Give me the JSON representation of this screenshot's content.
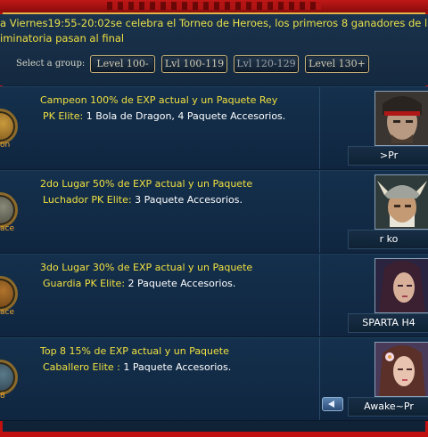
{
  "announcement": {
    "line1": "a Viernes19:55-20:02se celebra el Torneo de Heroes, los primeros 8 ganadores de la",
    "line2": "iminatoria pasan al final"
  },
  "group_select": {
    "label": "Select a group:",
    "buttons": [
      "Level 100-",
      "Lvl 100-119",
      "Lvl 120-129",
      "Level 130+"
    ]
  },
  "rows": [
    {
      "medal_text": "on",
      "title": "Campeon  100% de EXP actual y un Paquete Rey",
      "reward_class": "PK Elite:",
      "reward_text": " 1 Bola de Dragon, 4 Paquete Accesorios.",
      "player": ">Pr",
      "portrait": "warrior-headband-portrait"
    },
    {
      "medal_text": "ace",
      "title": "2do Lugar 50% de EXP actual y un Paquete",
      "reward_class": "Luchador PK Elite:",
      "reward_text": " 3 Paquete Accesorios.",
      "player": "r    ko",
      "portrait": "viking-helmet-portrait"
    },
    {
      "medal_text": "ace",
      "title": "3do Lugar 30% de EXP actual y un Paquete",
      "reward_class": "Guardia PK Elite:",
      "reward_text": " 2 Paquete Accesorios.",
      "player": "SPARTA H4",
      "portrait": "dark-haired-woman-portrait"
    },
    {
      "medal_text": "8",
      "title": "Top 8     15% de EXP actual y un Paquete",
      "reward_class": "Caballero Elite :",
      "reward_text": " 1 Paquete Accesorios.",
      "player": "Awake~Pr",
      "portrait": "flower-woman-portrait"
    }
  ],
  "colors": {
    "frame_red": "#c01010",
    "title_yellow": "#f0e040",
    "panel_blue": "#14304c"
  }
}
